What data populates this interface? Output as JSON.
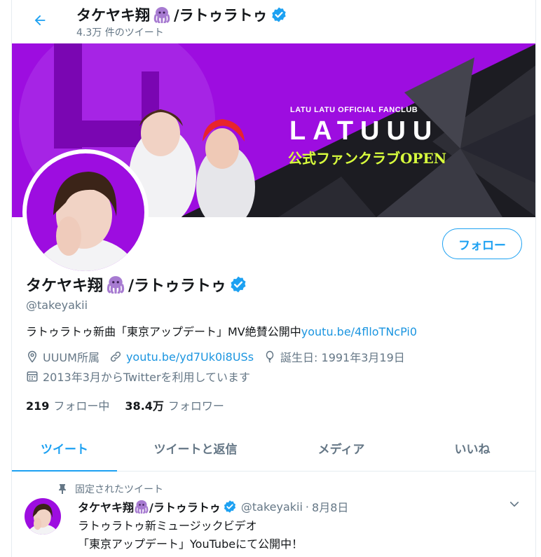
{
  "header": {
    "display_name": "タケヤキ翔",
    "name_suffix": "/ラトゥラトゥ",
    "tweet_count": "4.3万 件のツイート"
  },
  "banner": {
    "fanclub_label": "LATU LATU OFFICIAL FANCLUB",
    "logo_text": "LATUUU",
    "open_text": "公式ファンクラブOPEN"
  },
  "profile": {
    "display_name": "タケヤキ翔",
    "name_suffix": "/ラトゥラトゥ",
    "handle": "@takeyakii",
    "bio_text": "ラトゥラトゥ新曲「東京アップデート」MV絶賛公開中",
    "bio_link": "youtu.be/4flloTNcPi0",
    "location": "UUUM所属",
    "website": "youtu.be/yd7Uk0i8USs",
    "birthday": "誕生日: 1991年3月19日",
    "joined": "2013年3月からTwitterを利用しています",
    "following_count": "219",
    "following_label": "フォロー中",
    "followers_count": "38.4万",
    "followers_label": "フォロワー",
    "follow_button": "フォロー"
  },
  "tabs": [
    {
      "label": "ツイート",
      "active": true
    },
    {
      "label": "ツイートと返信",
      "active": false
    },
    {
      "label": "メディア",
      "active": false
    },
    {
      "label": "いいね",
      "active": false
    }
  ],
  "pinned_tweet": {
    "pinned_label": "固定されたツイート",
    "display_name": "タケヤキ翔",
    "name_suffix": "/ラトゥラトゥ",
    "handle": "@takeyakii",
    "separator": "·",
    "date": "8月8日",
    "line1": "ラトゥラトゥ新ミュージックビデオ",
    "line2": "「東京アップデート」YouTubeにて公開中！"
  },
  "colors": {
    "accent": "#1da1f2",
    "banner_purple": "#9d0de0",
    "text_secondary": "#657786",
    "verified": "#1da1f2"
  },
  "icons": [
    "back-arrow-icon",
    "octopus-emoji-icon",
    "verified-badge-icon",
    "location-icon",
    "link-icon",
    "balloon-icon",
    "calendar-icon",
    "pin-icon",
    "chevron-down-icon"
  ]
}
